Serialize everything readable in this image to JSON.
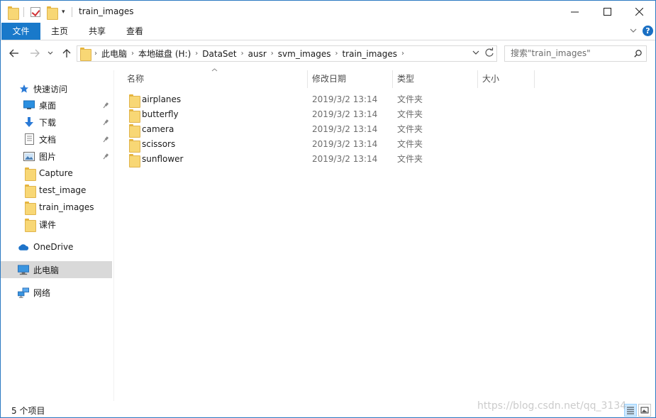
{
  "window": {
    "title": "train_images",
    "controls": [
      "minimize-icon",
      "maximize-icon",
      "close-icon"
    ]
  },
  "ribbon": {
    "tabs": [
      {
        "label": "文件"
      },
      {
        "label": "主页"
      },
      {
        "label": "共享"
      },
      {
        "label": "查看"
      }
    ],
    "help_label": "?"
  },
  "address": {
    "crumbs": [
      "此电脑",
      "本地磁盘 (H:)",
      "DataSet",
      "ausr",
      "svm_images",
      "train_images"
    ]
  },
  "search": {
    "placeholder": "搜索\"train_images\""
  },
  "sidebar": {
    "items": [
      {
        "label": "快速访问",
        "icon": "star-icon"
      },
      {
        "label": "桌面",
        "icon": "desktop-icon",
        "pinned": true
      },
      {
        "label": "下载",
        "icon": "download-icon",
        "pinned": true
      },
      {
        "label": "文档",
        "icon": "document-icon",
        "pinned": true
      },
      {
        "label": "图片",
        "icon": "picture-icon",
        "pinned": true
      },
      {
        "label": "Capture",
        "icon": "folder-icon"
      },
      {
        "label": "test_image",
        "icon": "folder-icon"
      },
      {
        "label": "train_images",
        "icon": "folder-icon"
      },
      {
        "label": "课件",
        "icon": "folder-icon"
      },
      {
        "label": "OneDrive",
        "icon": "cloud-icon"
      },
      {
        "label": "此电脑",
        "icon": "computer-icon",
        "selected": true
      },
      {
        "label": "网络",
        "icon": "network-icon"
      }
    ]
  },
  "columns": {
    "name": "名称",
    "date": "修改日期",
    "type": "类型",
    "size": "大小"
  },
  "files": [
    {
      "name": "airplanes",
      "date": "2019/3/2 13:14",
      "type": "文件夹"
    },
    {
      "name": "butterfly",
      "date": "2019/3/2 13:14",
      "type": "文件夹"
    },
    {
      "name": "camera",
      "date": "2019/3/2 13:14",
      "type": "文件夹"
    },
    {
      "name": "scissors",
      "date": "2019/3/2 13:14",
      "type": "文件夹"
    },
    {
      "name": "sunflower",
      "date": "2019/3/2 13:14",
      "type": "文件夹"
    }
  ],
  "status": {
    "item_count": "5 个项目"
  },
  "watermark": "https://blog.csdn.net/qq_3134"
}
